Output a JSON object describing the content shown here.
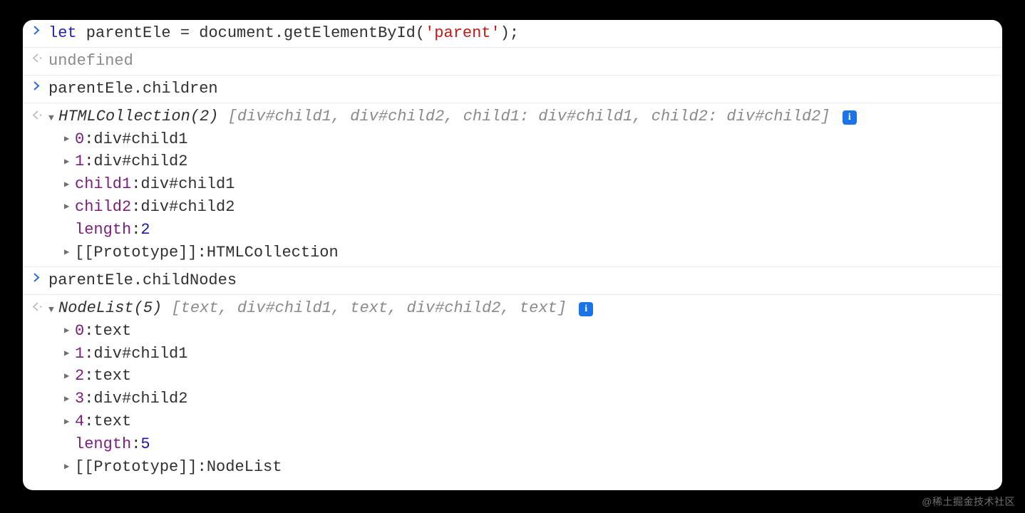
{
  "rows": {
    "input1": {
      "kw": "let",
      "code1": " parentEle = document.getElementById(",
      "str": "'parent'",
      "code2": ");"
    },
    "output1": "undefined",
    "input2": "parentEle.children",
    "output2": {
      "summary": "HTMLCollection(2) ",
      "preview": "[div#child1, div#child2, child1: div#child1, child2: div#child2]",
      "info": "i",
      "props": [
        {
          "key": "0",
          "sep": ": ",
          "val": "div#child1",
          "tri": true
        },
        {
          "key": "1",
          "sep": ": ",
          "val": "div#child2",
          "tri": true
        },
        {
          "key": "child1",
          "sep": ": ",
          "val": "div#child1",
          "tri": true
        },
        {
          "key": "child2",
          "sep": ": ",
          "val": "div#child2",
          "tri": true
        },
        {
          "key": "length",
          "sep": ": ",
          "num": "2",
          "tri": false
        },
        {
          "key": "[[Prototype]]",
          "sep": ": ",
          "val": "HTMLCollection",
          "tri": true,
          "keyColor": "#303030"
        }
      ]
    },
    "input3": "parentEle.childNodes",
    "output3": {
      "summary": "NodeList(5) ",
      "preview": "[text, div#child1, text, div#child2, text]",
      "info": "i",
      "props": [
        {
          "key": "0",
          "sep": ": ",
          "val": "text",
          "tri": true
        },
        {
          "key": "1",
          "sep": ": ",
          "val": "div#child1",
          "tri": true
        },
        {
          "key": "2",
          "sep": ": ",
          "val": "text",
          "tri": true
        },
        {
          "key": "3",
          "sep": ": ",
          "val": "div#child2",
          "tri": true
        },
        {
          "key": "4",
          "sep": ": ",
          "val": "text",
          "tri": true
        },
        {
          "key": "length",
          "sep": ": ",
          "num": "5",
          "tri": false
        },
        {
          "key": "[[Prototype]]",
          "sep": ": ",
          "val": "NodeList",
          "tri": true,
          "keyColor": "#303030"
        }
      ]
    }
  },
  "watermark": "@稀土掘金技术社区"
}
